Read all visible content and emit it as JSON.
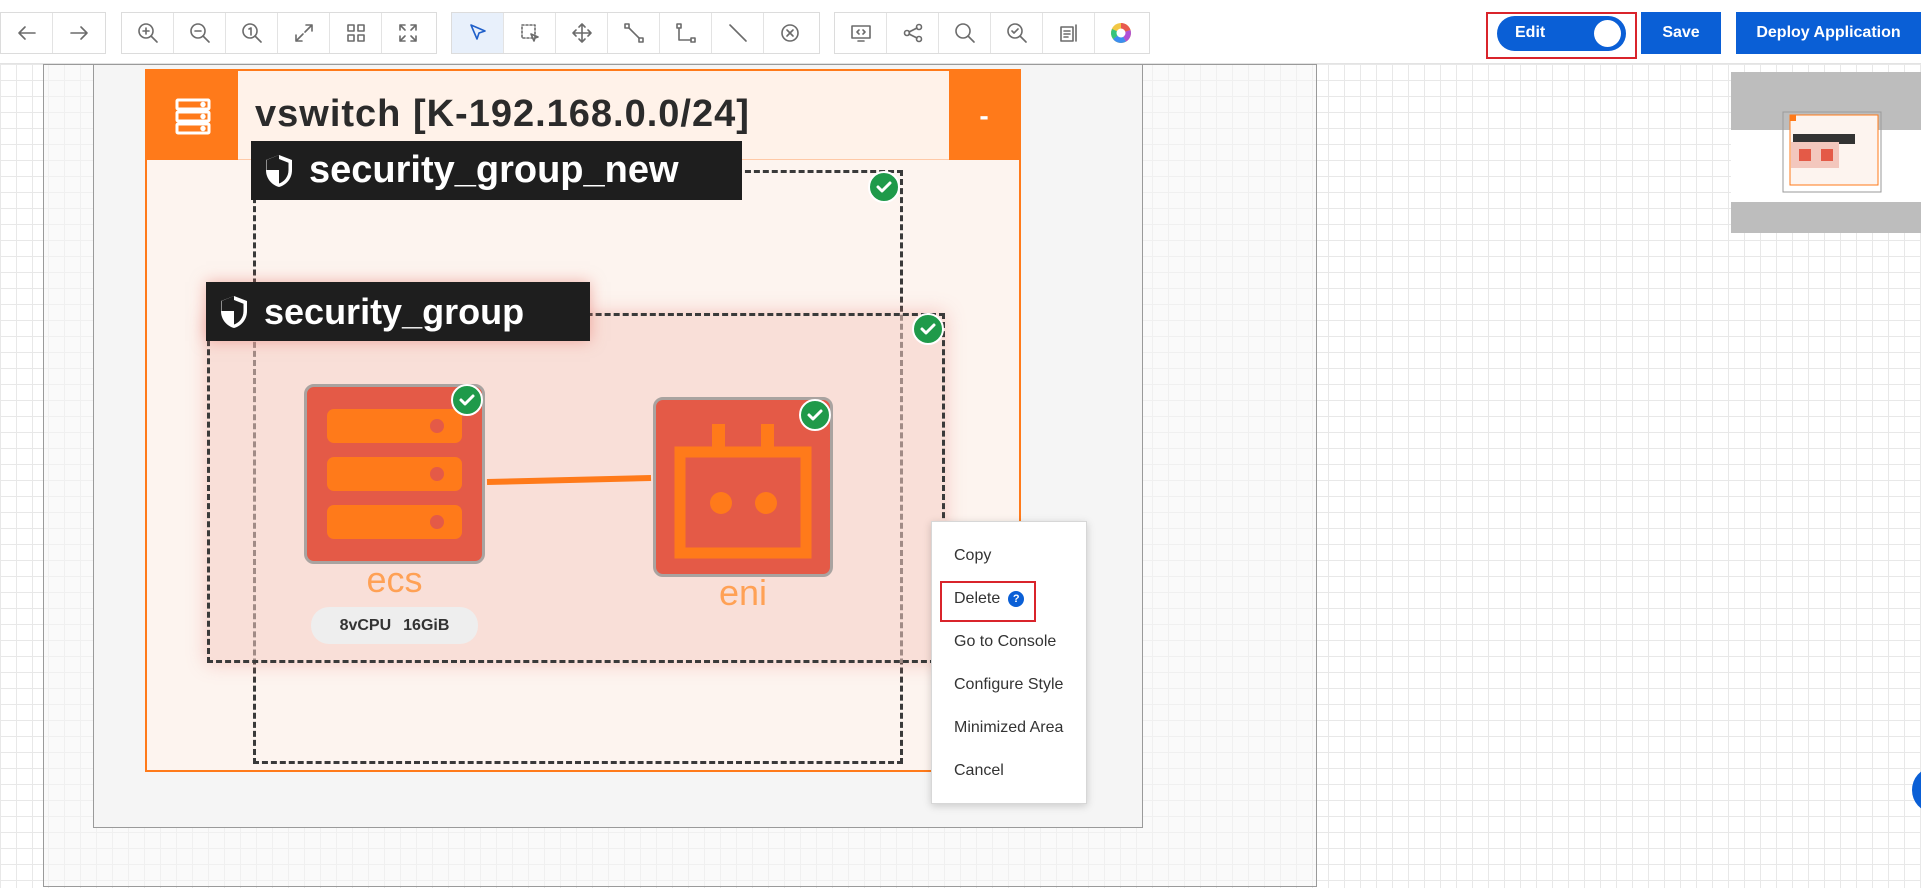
{
  "toolbar": {
    "history": [
      {
        "name": "undo-icon"
      },
      {
        "name": "redo-icon"
      }
    ],
    "view_tools": [
      {
        "name": "zoom-in-icon"
      },
      {
        "name": "zoom-out-icon"
      },
      {
        "name": "actual-size-icon"
      },
      {
        "name": "fit-screen-icon"
      },
      {
        "name": "grid-icon"
      },
      {
        "name": "fullscreen-icon"
      }
    ],
    "edit_tools": [
      {
        "name": "select-pointer-icon",
        "active": true
      },
      {
        "name": "marquee-select-icon"
      },
      {
        "name": "move-icon"
      },
      {
        "name": "connector-icon"
      },
      {
        "name": "orthogonal-connector-icon"
      },
      {
        "name": "line-icon"
      },
      {
        "name": "clear-icon"
      }
    ],
    "misc_tools": [
      {
        "name": "code-view-icon"
      },
      {
        "name": "share-icon"
      },
      {
        "name": "search-icon"
      },
      {
        "name": "inspect-icon"
      },
      {
        "name": "properties-icon"
      },
      {
        "name": "color-wheel-icon"
      }
    ],
    "edit_toggle": {
      "label": "Edit",
      "on": true
    },
    "save_label": "Save",
    "deploy_label": "Deploy Application"
  },
  "canvas": {
    "vswitch": {
      "title": "vswitch [K-192.168.0.0/24]",
      "collapse_label": "-",
      "icon": "server-stack-icon"
    },
    "security_group_new": {
      "label": "security_group_new",
      "icon": "shield-icon",
      "status": "ok"
    },
    "security_group": {
      "label": "security_group",
      "icon": "shield-icon",
      "status": "ok"
    },
    "nodes": [
      {
        "label": "ecs",
        "icon": "server-icon",
        "status": "ok",
        "specs": [
          "8vCPU",
          "16GiB"
        ]
      },
      {
        "label": "eni",
        "icon": "network-interface-icon",
        "status": "ok"
      }
    ]
  },
  "context_menu": {
    "items": [
      "Copy",
      "Delete",
      "Go to Console",
      "Configure Style",
      "Minimized Area",
      "Cancel"
    ],
    "help_icon": "?"
  },
  "colors": {
    "accent": "#0a5fd6",
    "vswitch": "#ff7a1a",
    "node": "#e45a47",
    "highlight": "#d9242b",
    "status_ok": "#1f9a4a"
  }
}
